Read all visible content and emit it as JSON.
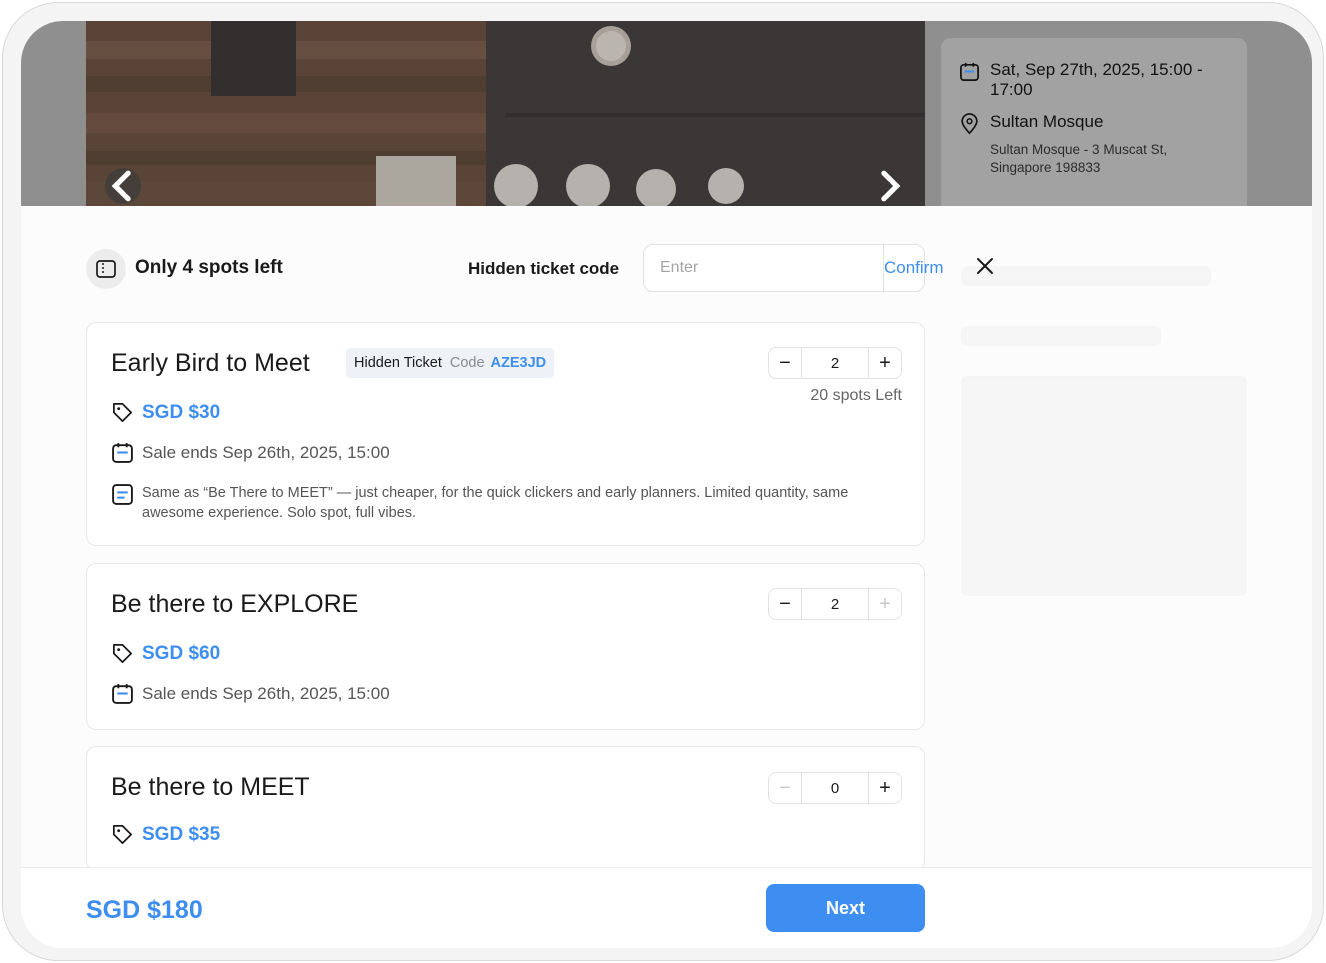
{
  "event": {
    "date": "Sat, Sep 27th, 2025, 15:00 - 17:00",
    "location": "Sultan Mosque",
    "address": "Sultan Mosque - 3 Muscat St, Singapore 198833"
  },
  "header": {
    "spots_text": "Only 4 spots left",
    "hidden_code_label": "Hidden ticket code",
    "code_placeholder": "Enter",
    "confirm_label": "Confirm"
  },
  "tickets": [
    {
      "title": "Early Bird to Meet",
      "hidden_tag": "Hidden Ticket",
      "code_label": "Code",
      "code": "AZE3JD",
      "price": "SGD $30",
      "sale_ends": "Sale ends Sep 26th, 2025, 15:00",
      "description": "Same as “Be There to MEET” — just cheaper, for the quick clickers and early planners. Limited quantity, same awesome experience. Solo spot, full vibes.",
      "quantity": "2",
      "spots_left": "20 spots Left"
    },
    {
      "title": "Be there to EXPLORE",
      "price": "SGD $60",
      "sale_ends": "Sale ends Sep 26th, 2025, 15:00",
      "quantity": "2"
    },
    {
      "title": "Be there to MEET",
      "price": "SGD $35",
      "quantity": "0"
    }
  ],
  "footer": {
    "total": "SGD $180",
    "next_label": "Next"
  },
  "colors": {
    "accent": "#3d8ef0"
  }
}
